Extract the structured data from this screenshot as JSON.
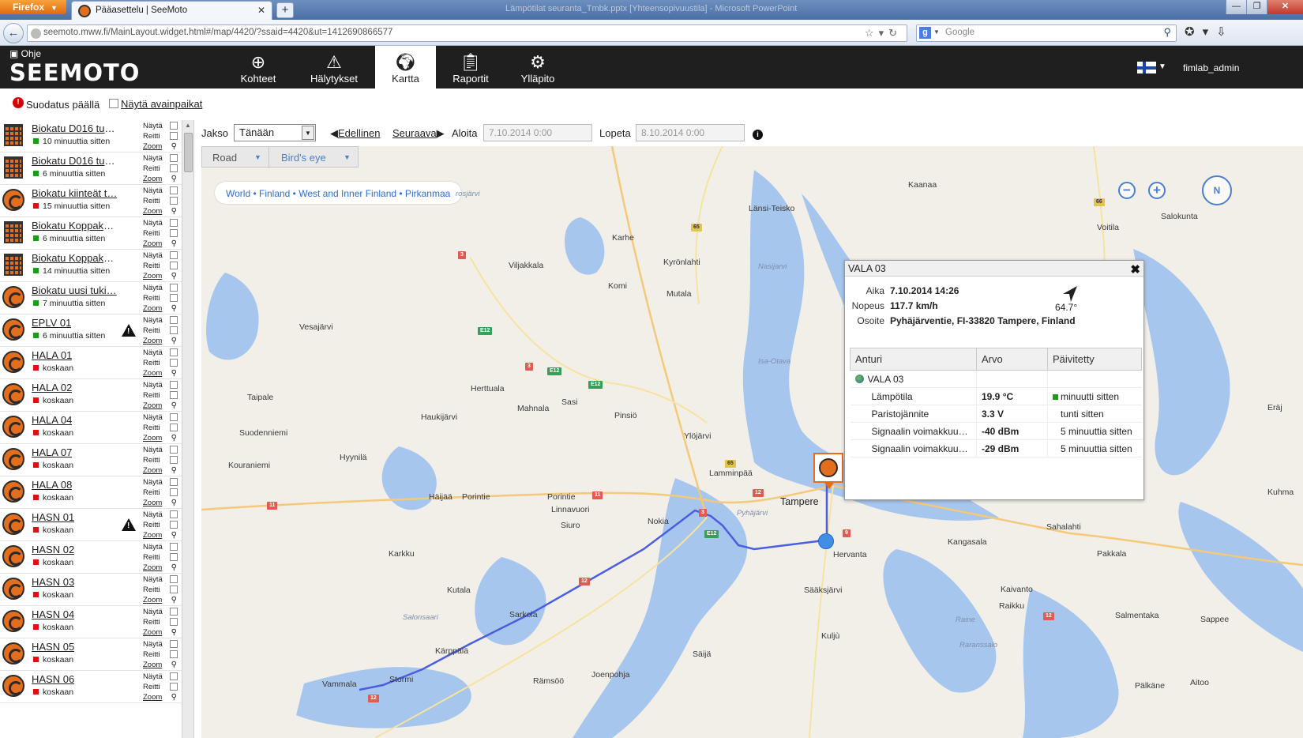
{
  "browser": {
    "menu_button": "Firefox",
    "tab_title": "Pääasettelu | SeeMoto",
    "new_tab": "+",
    "window_title": "Lämpötilat seuranta_Tmbk.pptx [Yhteensopivuustila] - Microsoft PowerPoint",
    "url": "seemoto.mww.fi/MainLayout.widget.html#/map/4420/?ssaid=4420&ut=1412690866577",
    "search_engine": "g",
    "search_placeholder": "Google"
  },
  "app": {
    "help": "Ohje",
    "logo": "SEEMOTO",
    "nav": [
      {
        "label": "Kohteet",
        "icon": "crosshair-icon",
        "active": false
      },
      {
        "label": "Hälytykset",
        "icon": "warning-icon",
        "active": false
      },
      {
        "label": "Kartta",
        "icon": "globe-icon",
        "active": true
      },
      {
        "label": "Raportit",
        "icon": "clipboard-icon",
        "active": false
      },
      {
        "label": "Ylläpito",
        "icon": "gear-icon",
        "active": false
      }
    ],
    "user": "fimlab_admin"
  },
  "filters": {
    "filter_status": "Suodatus päällä",
    "show_hotspots": "Näytä avainpaikat"
  },
  "period": {
    "label": "Jakso",
    "selected": "Tänään",
    "prev": "Edellinen",
    "next": "Seuraava",
    "start_label": "Aloita",
    "start_value": "7.10.2014 0:00",
    "end_label": "Lopeta",
    "end_value": "8.10.2014 0:00"
  },
  "device_links": {
    "show": "Näytä",
    "route": "Reitti",
    "zoom": "Zoom"
  },
  "devices": [
    {
      "name": "Biokatu D016 tuk…",
      "status": "10 minuuttia sitten",
      "color": "green",
      "icon": "building",
      "alert": false
    },
    {
      "name": "Biokatu D016 tuk…",
      "status": "6 minuuttia sitten",
      "color": "green",
      "icon": "building",
      "alert": false
    },
    {
      "name": "Biokatu kiinteät t…",
      "status": "15 minuuttia sitten",
      "color": "red",
      "icon": "car",
      "alert": false
    },
    {
      "name": "Biokatu Koppakui…",
      "status": "6 minuuttia sitten",
      "color": "green",
      "icon": "building",
      "alert": false
    },
    {
      "name": "Biokatu Koppakui…",
      "status": "14 minuuttia sitten",
      "color": "green",
      "icon": "building",
      "alert": false
    },
    {
      "name": "Biokatu uusi tuki…",
      "status": "7 minuuttia sitten",
      "color": "green",
      "icon": "car",
      "alert": false
    },
    {
      "name": "EPLV 01",
      "status": "6 minuuttia sitten",
      "color": "green",
      "icon": "car",
      "alert": true
    },
    {
      "name": "HALA 01",
      "status": "koskaan",
      "color": "red",
      "icon": "car",
      "alert": false
    },
    {
      "name": "HALA 02",
      "status": "koskaan",
      "color": "red",
      "icon": "car",
      "alert": false
    },
    {
      "name": "HALA 04",
      "status": "koskaan",
      "color": "red",
      "icon": "car",
      "alert": false
    },
    {
      "name": "HALA 07",
      "status": "koskaan",
      "color": "red",
      "icon": "car",
      "alert": false
    },
    {
      "name": "HALA 08",
      "status": "koskaan",
      "color": "red",
      "icon": "car",
      "alert": false
    },
    {
      "name": "HASN 01",
      "status": "koskaan",
      "color": "red",
      "icon": "car",
      "alert": true
    },
    {
      "name": "HASN 02",
      "status": "koskaan",
      "color": "red",
      "icon": "car",
      "alert": false
    },
    {
      "name": "HASN 03",
      "status": "koskaan",
      "color": "red",
      "icon": "car",
      "alert": false
    },
    {
      "name": "HASN 04",
      "status": "koskaan",
      "color": "red",
      "icon": "car",
      "alert": false
    },
    {
      "name": "HASN 05",
      "status": "koskaan",
      "color": "red",
      "icon": "car",
      "alert": false
    },
    {
      "name": "HASN 06",
      "status": "koskaan",
      "color": "red",
      "icon": "car",
      "alert": false
    }
  ],
  "map": {
    "type_road": "Road",
    "type_birdseye": "Bird's eye",
    "breadcrumb": "World • Finland • West and Inner Finland • Pirkanmaa",
    "compass": "N",
    "places": [
      {
        "t": "Kaanaa",
        "c": "place"
      },
      {
        "t": "Länsi-Teisko",
        "c": "place"
      },
      {
        "t": "Salokunta",
        "c": "place"
      },
      {
        "t": "Voitila",
        "c": "place"
      },
      {
        "t": "Karhe",
        "c": "place"
      },
      {
        "t": "Viljakkala",
        "c": "place"
      },
      {
        "t": "Kyrönlahti",
        "c": "place"
      },
      {
        "t": "Komi",
        "c": "place"
      },
      {
        "t": "Mutala",
        "c": "place"
      },
      {
        "t": "Vesajärvi",
        "c": "place"
      },
      {
        "t": "Taipale",
        "c": "place"
      },
      {
        "t": "Herttuala",
        "c": "place"
      },
      {
        "t": "Mahnala",
        "c": "place"
      },
      {
        "t": "Sasi",
        "c": "place"
      },
      {
        "t": "Pinsiö",
        "c": "place"
      },
      {
        "t": "Haukijärvi",
        "c": "place"
      },
      {
        "t": "Suodenniemi",
        "c": "place"
      },
      {
        "t": "Ylöjärvi",
        "c": "place"
      },
      {
        "t": "Hyynilä",
        "c": "place"
      },
      {
        "t": "Kouraniemi",
        "c": "place"
      },
      {
        "t": "Lamminpää",
        "c": "place"
      },
      {
        "t": "Häijää",
        "c": "place"
      },
      {
        "t": "Porintie",
        "c": "place"
      },
      {
        "t": "Porintie",
        "c": "place"
      },
      {
        "t": "Linnavuori",
        "c": "place"
      },
      {
        "t": "Tampere",
        "c": "place city"
      },
      {
        "t": "Nokia",
        "c": "place"
      },
      {
        "t": "Siuro",
        "c": "place"
      },
      {
        "t": "Karkku",
        "c": "place"
      },
      {
        "t": "Hervanta",
        "c": "place"
      },
      {
        "t": "Kangasala",
        "c": "place"
      },
      {
        "t": "Sahalahti",
        "c": "place"
      },
      {
        "t": "Pakkala",
        "c": "place"
      },
      {
        "t": "Kutala",
        "c": "place"
      },
      {
        "t": "Sääksjärvi",
        "c": "place"
      },
      {
        "t": "Kaivanto",
        "c": "place"
      },
      {
        "t": "Raikku",
        "c": "place"
      },
      {
        "t": "Salmentaka",
        "c": "place"
      },
      {
        "t": "Sappee",
        "c": "place"
      },
      {
        "t": "Sarkola",
        "c": "place"
      },
      {
        "t": "Kuljù",
        "c": "place"
      },
      {
        "t": "Kärppälä",
        "c": "place"
      },
      {
        "t": "Säijä",
        "c": "place"
      },
      {
        "t": "Stormi",
        "c": "place"
      },
      {
        "t": "Vammala",
        "c": "place"
      },
      {
        "t": "Rämsöö",
        "c": "place"
      },
      {
        "t": "Joenpohja",
        "c": "place"
      },
      {
        "t": "Pälkäne",
        "c": "place"
      },
      {
        "t": "Aitoo",
        "c": "place"
      },
      {
        "t": "Kuhma",
        "c": "place"
      },
      {
        "t": "Eräj",
        "c": "place"
      },
      {
        "t": "Nasijarvi",
        "c": "place water"
      },
      {
        "t": "Isa-Otava",
        "c": "place water"
      },
      {
        "t": "Pyhäjärvi",
        "c": "place water"
      },
      {
        "t": "Salonsaari",
        "c": "place water"
      },
      {
        "t": "Raine",
        "c": "place water"
      },
      {
        "t": "Raranssalo",
        "c": "place water"
      },
      {
        "t": "rosjärvi",
        "c": "place water"
      }
    ],
    "roads": [
      {
        "t": "66",
        "c": "road-badge yellow"
      },
      {
        "t": "65",
        "c": "road-badge yellow"
      },
      {
        "t": "3",
        "c": "road-badge red"
      },
      {
        "t": "E12",
        "c": "road-badge green"
      },
      {
        "t": "3",
        "c": "road-badge red"
      },
      {
        "t": "E12",
        "c": "road-badge green"
      },
      {
        "t": "E12",
        "c": "road-badge green"
      },
      {
        "t": "65",
        "c": "road-badge yellow"
      },
      {
        "t": "12",
        "c": "road-badge red"
      },
      {
        "t": "11",
        "c": "road-badge red"
      },
      {
        "t": "11",
        "c": "road-badge red"
      },
      {
        "t": "3",
        "c": "road-badge red"
      },
      {
        "t": "E12",
        "c": "road-badge green"
      },
      {
        "t": "9",
        "c": "road-badge red"
      },
      {
        "t": "12",
        "c": "road-badge red"
      },
      {
        "t": "12",
        "c": "road-badge red"
      },
      {
        "t": "12",
        "c": "road-badge red"
      }
    ]
  },
  "popup": {
    "title": "VALA 03",
    "time_label": "Aika",
    "time_value": "7.10.2014 14:26",
    "speed_label": "Nopeus",
    "speed_value": "117.7 km/h",
    "address_label": "Osoite",
    "address_value": "Pyhäjärventie, FI-33820 Tampere, Finland",
    "heading": "64.7°",
    "table": {
      "headers": [
        "Anturi",
        "Arvo",
        "Päivitetty"
      ],
      "group": "VALA 03",
      "rows": [
        {
          "sensor": "Lämpötila",
          "value": "19.9 °C",
          "updated": "minuutti sitten",
          "fresh": true
        },
        {
          "sensor": "Paristojännite",
          "value": "3.3 V",
          "updated": "tunti sitten",
          "fresh": false
        },
        {
          "sensor": "Signaalin voimakkuu…",
          "value": "-40 dBm",
          "updated": "5 minuuttia sitten",
          "fresh": false
        },
        {
          "sensor": "Signaalin voimakkuu…",
          "value": "-29 dBm",
          "updated": "5 minuuttia sitten",
          "fresh": false
        }
      ]
    }
  },
  "colors": {
    "accent": "#e36f1e",
    "route": "#4a5ee0",
    "water": "#a7c6ee",
    "status_green": "#179e17",
    "status_red": "#e01010"
  }
}
